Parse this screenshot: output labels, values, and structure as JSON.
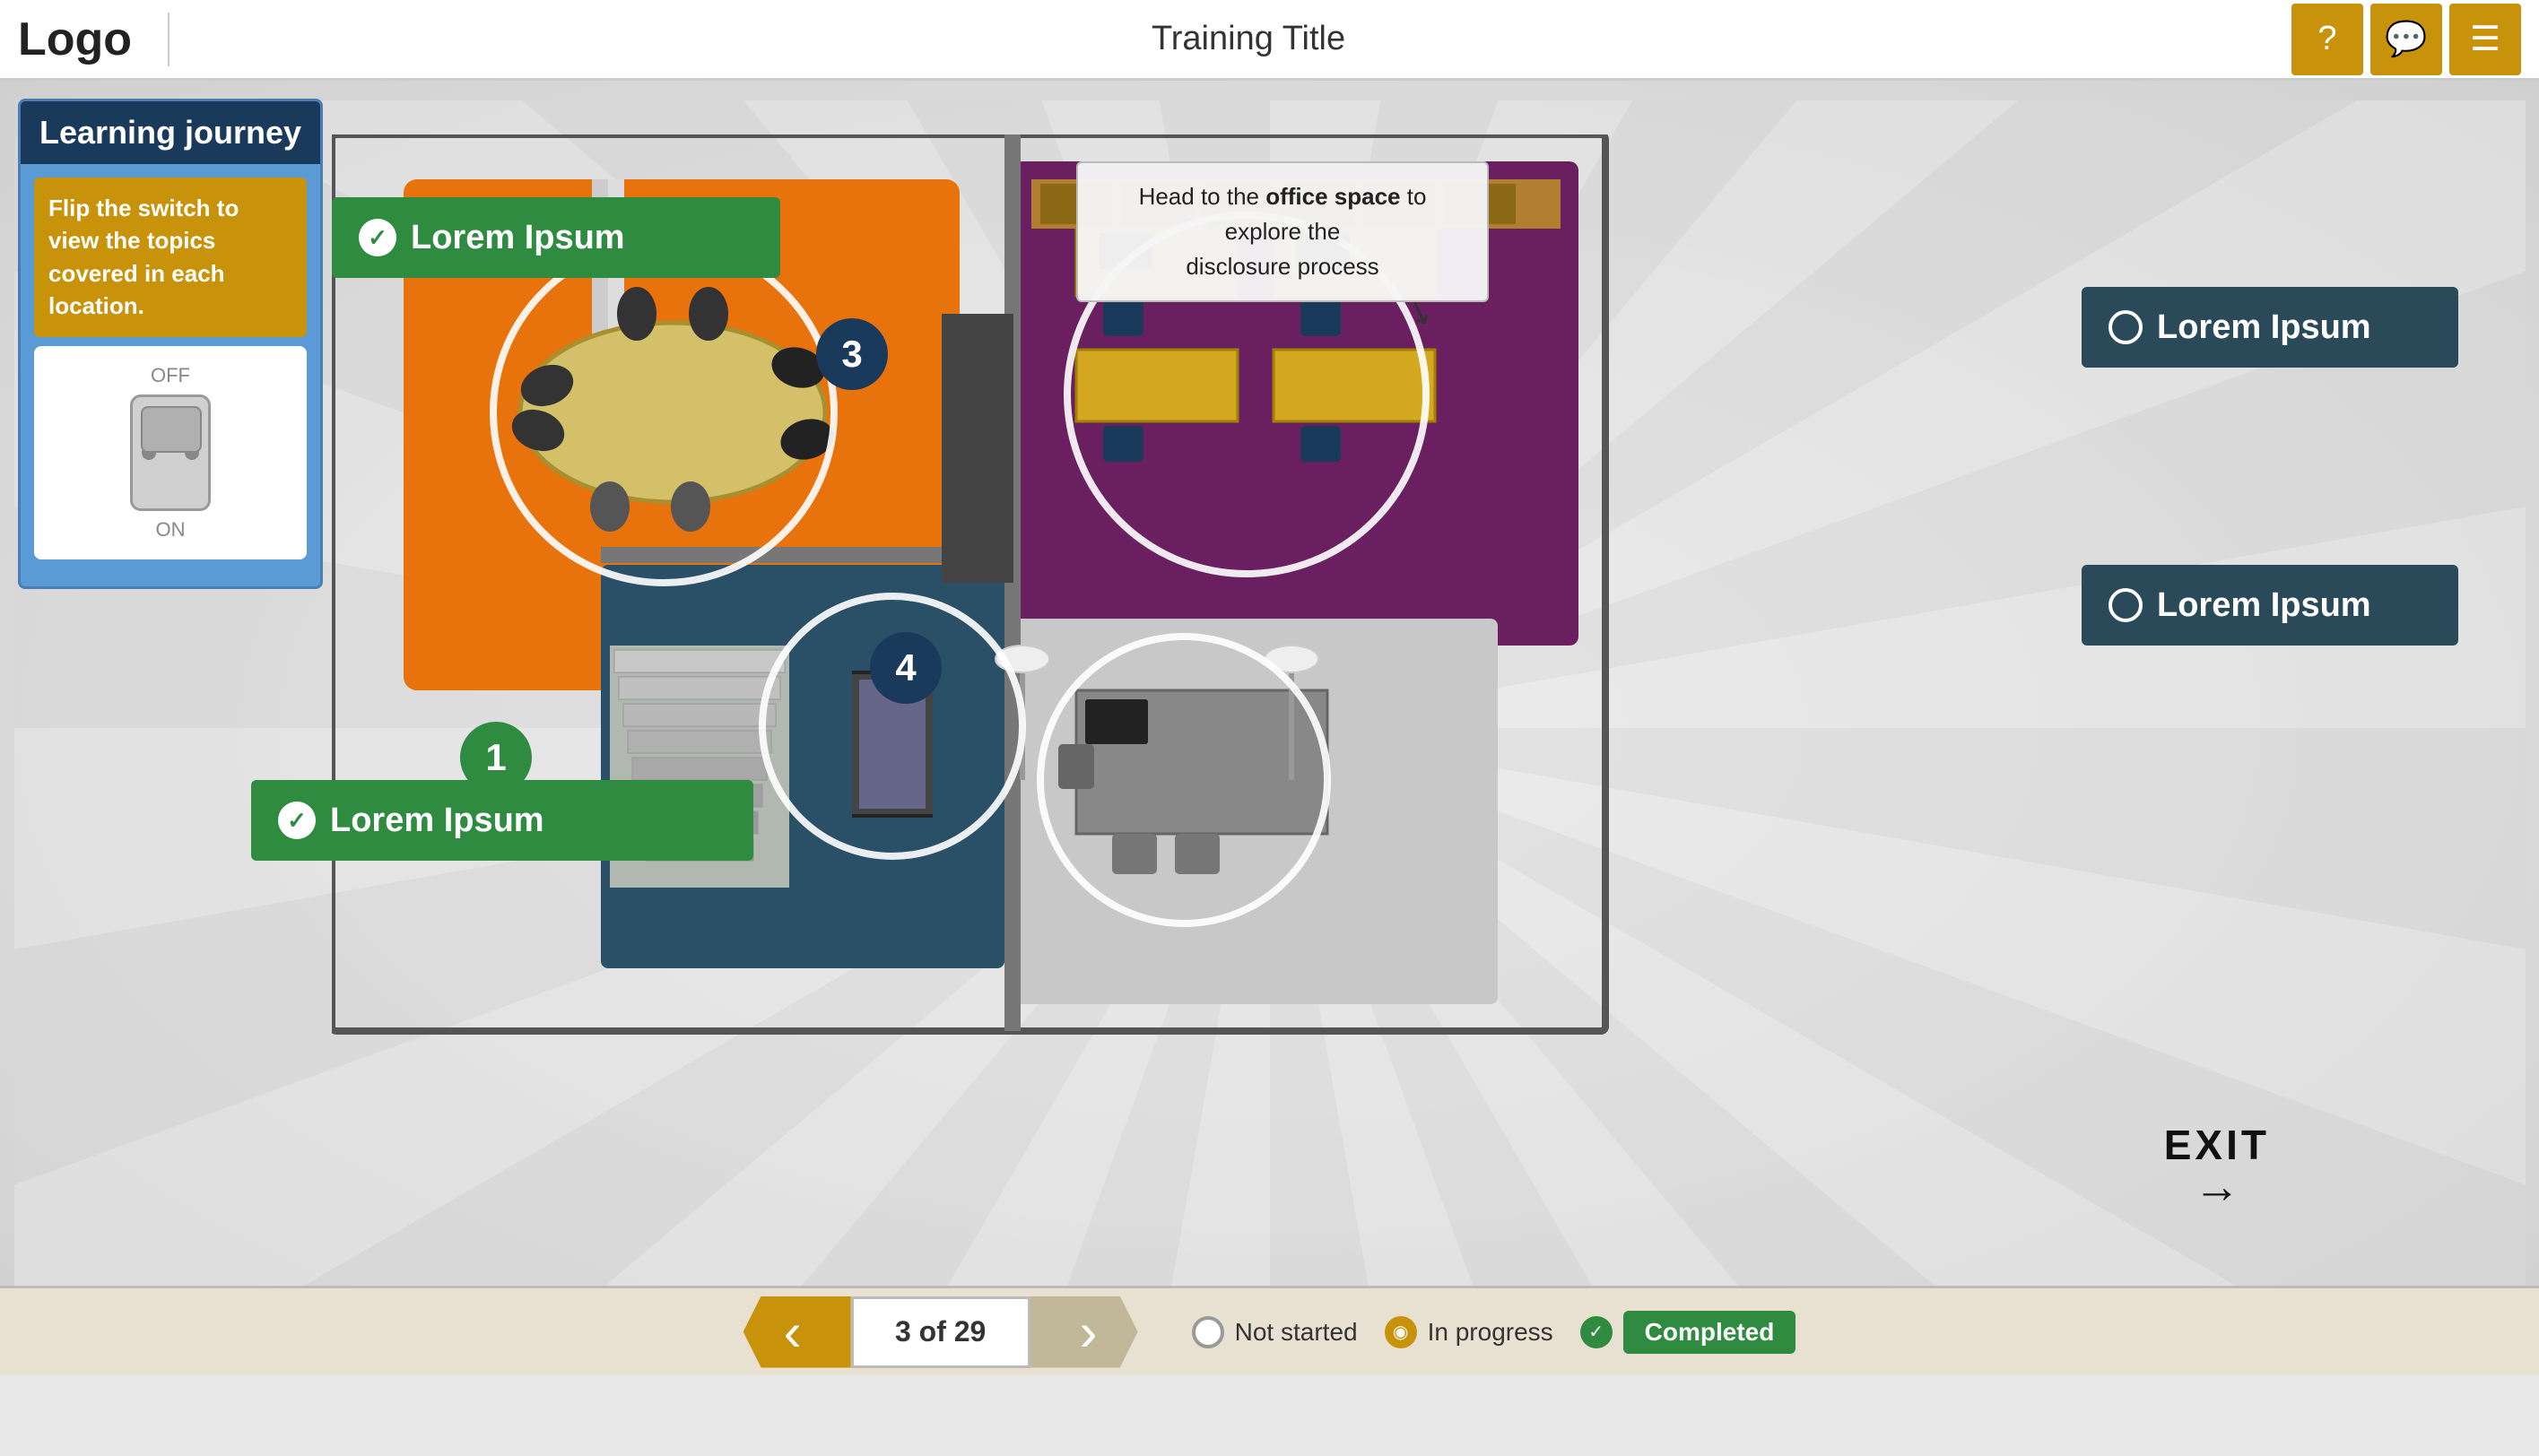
{
  "header": {
    "logo": "Logo",
    "title": "Training Title",
    "help_label": "?",
    "chat_label": "💬",
    "menu_label": "☰"
  },
  "learning_journey": {
    "title": "Learning journey",
    "description": "Flip the switch to view the topics covered in each location.",
    "switch_off": "OFF",
    "switch_on": "ON"
  },
  "callout": {
    "text": "Head to the office space to explore the disclosure process"
  },
  "locations": [
    {
      "id": 1,
      "label": "Lorem Ipsum",
      "status": "completed",
      "badge_color": "green"
    },
    {
      "id": 2,
      "label": "Lorem Ipsum",
      "status": "completed",
      "badge_color": "green"
    },
    {
      "id": 3,
      "label": "Lorem Ipsum",
      "status": "not_started",
      "badge_color": "dark"
    },
    {
      "id": 4,
      "label": "Lorem Ipsum",
      "status": "not_started",
      "badge_color": "dark"
    }
  ],
  "exit": {
    "label": "EXIT",
    "arrow": "→"
  },
  "footer": {
    "prev_label": "‹",
    "next_label": "›",
    "page_counter": "3 of 29",
    "legend": {
      "not_started": "Not started",
      "in_progress": "In progress",
      "completed": "Completed"
    }
  }
}
